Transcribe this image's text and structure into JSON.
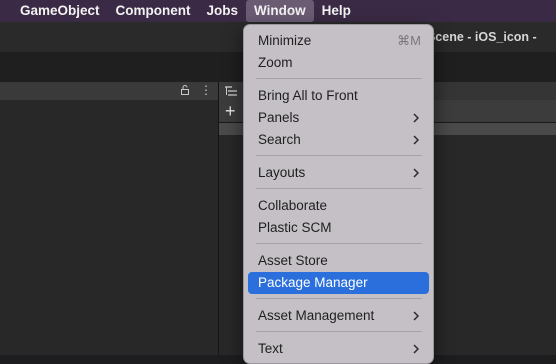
{
  "menubar": {
    "items": [
      "GameObject",
      "Component",
      "Jobs",
      "Window",
      "Help"
    ],
    "active_index": 3
  },
  "window_title": "eScene - iOS_icon -",
  "window_menu": {
    "items": [
      {
        "label": "Minimize",
        "shortcut": "⌘M",
        "submenu": false
      },
      {
        "label": "Zoom",
        "shortcut": "",
        "submenu": false
      },
      {
        "label": "Bring All to Front",
        "shortcut": "",
        "submenu": false
      },
      {
        "label": "Panels",
        "shortcut": "",
        "submenu": true
      },
      {
        "label": "Search",
        "shortcut": "",
        "submenu": true
      },
      {
        "label": "Layouts",
        "shortcut": "",
        "submenu": true
      },
      {
        "label": "Collaborate",
        "shortcut": "",
        "submenu": false
      },
      {
        "label": "Plastic SCM",
        "shortcut": "",
        "submenu": false
      },
      {
        "label": "Asset Store",
        "shortcut": "",
        "submenu": false
      },
      {
        "label": "Package Manager",
        "shortcut": "",
        "submenu": false
      },
      {
        "label": "Asset Management",
        "shortcut": "",
        "submenu": true
      },
      {
        "label": "Text",
        "shortcut": "",
        "submenu": true
      }
    ],
    "highlighted": "Package Manager"
  },
  "colors": {
    "menubar_bg": "#3b2a45",
    "menu_bg": "#c4c0c5",
    "highlight": "#2a6fdb"
  }
}
